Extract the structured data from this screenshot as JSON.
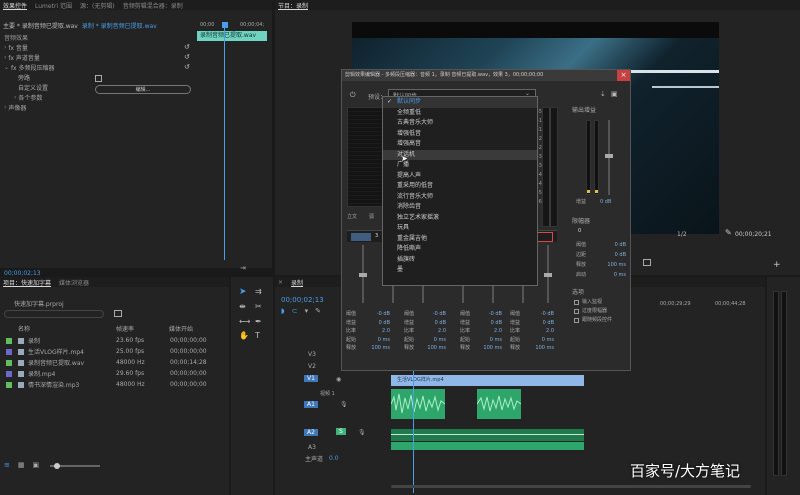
{
  "effect_controls": {
    "tabs": [
      "效果控件",
      "Lumetri 范围",
      "源：(无剪辑)",
      "音频剪辑混合器：录制"
    ],
    "clip_label": "主要 * 录制音频已提取.wav",
    "sequence_label": "录制 * 录制音频已提取.wav",
    "timecode_a": "00;00",
    "timecode_b": "00;00;04;",
    "section": "音频效果",
    "params": [
      {
        "label": "fx 音量"
      },
      {
        "label": "fx 声道音量"
      },
      {
        "label": "fx 多频段压缩器"
      },
      {
        "label": "旁路"
      },
      {
        "label": "自定义设置"
      },
      {
        "label": "各个参数"
      },
      {
        "label": "声像器"
      }
    ],
    "edit_button": "编辑...",
    "clip_bar": "录制音频已提取.wav",
    "current_timecode": "00;00;02;13"
  },
  "program": {
    "tab": "节目：录制",
    "timecode_right": "00;00;20;21",
    "scale": "1/2"
  },
  "dialog": {
    "title": "剪辑效果编辑器 - 多频段压缩器：音频 1，录制 音频已提取.wav，效果 3，00;00;00;00",
    "preset_label": "预设：",
    "preset_value": "默认同步",
    "output_gain_label": "输出增益",
    "gain_label": "增益",
    "gain_value": "0 dB",
    "limiter_label": "限幅器",
    "limiter_value": "0",
    "limiter_params": [
      {
        "label": "阈值",
        "value": "0 dB"
      },
      {
        "label": "边距",
        "value": "0 dB"
      },
      {
        "label": "释放",
        "value": "100 ms"
      },
      {
        "label": "启动",
        "value": "0 ms"
      }
    ],
    "options_label": "选项",
    "options": [
      "输入监视",
      "过度限幅器",
      "跟随频段控件"
    ],
    "solo_label": "独奏",
    "band_labels": [
      "阈值",
      "增益",
      "比率",
      "起始",
      "释放"
    ],
    "band_values": [
      [
        "-0 dB",
        "0 dB",
        "2.0",
        "0 ms",
        "100 ms"
      ],
      [
        "-0 dB",
        "0 dB",
        "2.0",
        "0 ms",
        "100 ms"
      ],
      [
        "-0 dB",
        "0 dB",
        "2.0",
        "0 ms",
        "100 ms"
      ],
      [
        "-0 dB",
        "0 dB",
        "2.0",
        "0 ms",
        "100 ms"
      ]
    ],
    "band_number": "3",
    "db_scale": [
      "-5",
      "-10",
      "-15",
      "-20",
      "-25",
      "-30",
      "-35",
      "-40",
      "-45",
      "-50",
      "-60"
    ],
    "left_axis": "立文",
    "left_axis2": "弧"
  },
  "presets_dropdown": [
    {
      "label": "默认同步",
      "checked": true
    },
    {
      "label": "全频重低"
    },
    {
      "label": "古典音乐大师"
    },
    {
      "label": "增强低音"
    },
    {
      "label": "增强高音"
    },
    {
      "label": "对话机"
    },
    {
      "label": "广播"
    },
    {
      "label": "提高人声"
    },
    {
      "label": "重采用的低音"
    },
    {
      "label": "流行音乐大师"
    },
    {
      "label": "消除齿音"
    },
    {
      "label": "独立艺术家摇滚"
    },
    {
      "label": "玩具"
    },
    {
      "label": "重金属吉他"
    },
    {
      "label": "降低嘶声"
    },
    {
      "label": "插旗砖"
    },
    {
      "label": "墨"
    }
  ],
  "project": {
    "tabs": [
      "项目：快速加字幕",
      "媒体浏览器"
    ],
    "timecode": "00;00;02;13",
    "file": "快速加字幕.prproj",
    "columns": [
      "名称",
      "帧速率",
      "媒体开始"
    ],
    "items": [
      {
        "name": "录制",
        "rate": "23.60 fps",
        "start": "00;00;00;00",
        "color": "#5fbf5f"
      },
      {
        "name": "生活VLOG样片.mp4",
        "rate": "25.00 fps",
        "start": "00;00;00;00",
        "color": "#6a6ac8"
      },
      {
        "name": "录制音频已提取.wav",
        "rate": "48000 Hz",
        "start": "00;00;14;28",
        "color": "#5fbf5f"
      },
      {
        "name": "录制.mp4",
        "rate": "29.60 fps",
        "start": "00;00;00;00",
        "color": "#6a6ac8"
      },
      {
        "name": "情书深情渲染.mp3",
        "rate": "48000 Hz",
        "start": "00;00;00;00",
        "color": "#5fbf5f"
      }
    ]
  },
  "timeline": {
    "tab": "录制",
    "timecode": "00;00;02;13",
    "ruler": [
      "00;00;29;29",
      "00;00;44;28"
    ],
    "tracks_video": [
      "V3",
      "V2",
      "V1"
    ],
    "tracks_audio": [
      "A1",
      "A2",
      "A3"
    ],
    "master": "主声道",
    "master_value": "0.0",
    "video_clip": "生活VLOG样片.mp4",
    "track_name": "视频 1"
  },
  "watermark": "百家号/大方笔记",
  "colors": {
    "accent": "#4a9de8",
    "clip_video": "#8fb8e8",
    "clip_audio": "#2ea56a",
    "clip_audio_dark": "#1f7a4e"
  }
}
